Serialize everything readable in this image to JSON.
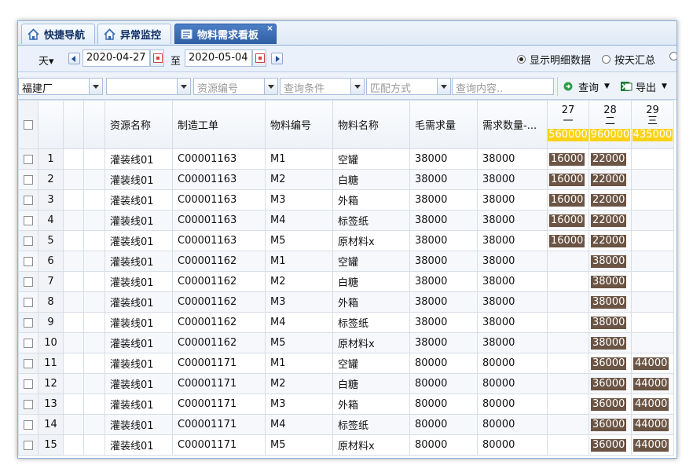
{
  "tabs": [
    {
      "label": "快捷导航",
      "icon": "home-icon"
    },
    {
      "label": "异常监控",
      "icon": "home-icon"
    },
    {
      "label": "物料需求看板",
      "icon": "board-icon"
    }
  ],
  "tab_close": "×",
  "datebar": {
    "unit": "天▾",
    "start_date": "2020-04-27",
    "to_label": "至",
    "end_date": "2020-05-04",
    "radio_detail": "显示明细数据",
    "radio_daily": "按天汇总"
  },
  "filters": {
    "factory": "福建厂",
    "blank": "",
    "resource_placeholder": "资源编号",
    "condition_placeholder": "查询条件",
    "match_placeholder": "匹配方式",
    "content_placeholder": "查询内容..",
    "query_label": "查询",
    "export_label": "导出"
  },
  "columns": [
    "资源名称",
    "制造工单",
    "物料编号",
    "物料名称",
    "毛需求量",
    "需求数量-..."
  ],
  "days": [
    {
      "day": "27",
      "weekday": "一",
      "total": "560000"
    },
    {
      "day": "28",
      "weekday": "二",
      "total": "960000"
    },
    {
      "day": "29",
      "weekday": "三",
      "total": "435000"
    }
  ],
  "rows": [
    {
      "n": "1",
      "res": "灌装线01",
      "order": "C00001163",
      "code": "M1",
      "name": "空罐",
      "gross": "38000",
      "qty": "38000",
      "d27": "16000",
      "d28": "22000",
      "d29": ""
    },
    {
      "n": "2",
      "res": "灌装线01",
      "order": "C00001163",
      "code": "M2",
      "name": "白糖",
      "gross": "38000",
      "qty": "38000",
      "d27": "16000",
      "d28": "22000",
      "d29": ""
    },
    {
      "n": "3",
      "res": "灌装线01",
      "order": "C00001163",
      "code": "M3",
      "name": "外箱",
      "gross": "38000",
      "qty": "38000",
      "d27": "16000",
      "d28": "22000",
      "d29": ""
    },
    {
      "n": "4",
      "res": "灌装线01",
      "order": "C00001163",
      "code": "M4",
      "name": "标签纸",
      "gross": "38000",
      "qty": "38000",
      "d27": "16000",
      "d28": "22000",
      "d29": ""
    },
    {
      "n": "5",
      "res": "灌装线01",
      "order": "C00001163",
      "code": "M5",
      "name": "原材料x",
      "gross": "38000",
      "qty": "38000",
      "d27": "16000",
      "d28": "22000",
      "d29": ""
    },
    {
      "n": "6",
      "res": "灌装线01",
      "order": "C00001162",
      "code": "M1",
      "name": "空罐",
      "gross": "38000",
      "qty": "38000",
      "d27": "",
      "d28": "38000",
      "d29": ""
    },
    {
      "n": "7",
      "res": "灌装线01",
      "order": "C00001162",
      "code": "M2",
      "name": "白糖",
      "gross": "38000",
      "qty": "38000",
      "d27": "",
      "d28": "38000",
      "d29": ""
    },
    {
      "n": "8",
      "res": "灌装线01",
      "order": "C00001162",
      "code": "M3",
      "name": "外箱",
      "gross": "38000",
      "qty": "38000",
      "d27": "",
      "d28": "38000",
      "d29": ""
    },
    {
      "n": "9",
      "res": "灌装线01",
      "order": "C00001162",
      "code": "M4",
      "name": "标签纸",
      "gross": "38000",
      "qty": "38000",
      "d27": "",
      "d28": "38000",
      "d29": ""
    },
    {
      "n": "10",
      "res": "灌装线01",
      "order": "C00001162",
      "code": "M5",
      "name": "原材料x",
      "gross": "38000",
      "qty": "38000",
      "d27": "",
      "d28": "38000",
      "d29": ""
    },
    {
      "n": "11",
      "res": "灌装线01",
      "order": "C00001171",
      "code": "M1",
      "name": "空罐",
      "gross": "80000",
      "qty": "80000",
      "d27": "",
      "d28": "36000",
      "d29": "44000"
    },
    {
      "n": "12",
      "res": "灌装线01",
      "order": "C00001171",
      "code": "M2",
      "name": "白糖",
      "gross": "80000",
      "qty": "80000",
      "d27": "",
      "d28": "36000",
      "d29": "44000"
    },
    {
      "n": "13",
      "res": "灌装线01",
      "order": "C00001171",
      "code": "M3",
      "name": "外箱",
      "gross": "80000",
      "qty": "80000",
      "d27": "",
      "d28": "36000",
      "d29": "44000"
    },
    {
      "n": "14",
      "res": "灌装线01",
      "order": "C00001171",
      "code": "M4",
      "name": "标签纸",
      "gross": "80000",
      "qty": "80000",
      "d27": "",
      "d28": "36000",
      "d29": "44000"
    },
    {
      "n": "15",
      "res": "灌装线01",
      "order": "C00001171",
      "code": "M5",
      "name": "原材料x",
      "gross": "80000",
      "qty": "80000",
      "d27": "",
      "d28": "36000",
      "d29": "44000"
    }
  ]
}
